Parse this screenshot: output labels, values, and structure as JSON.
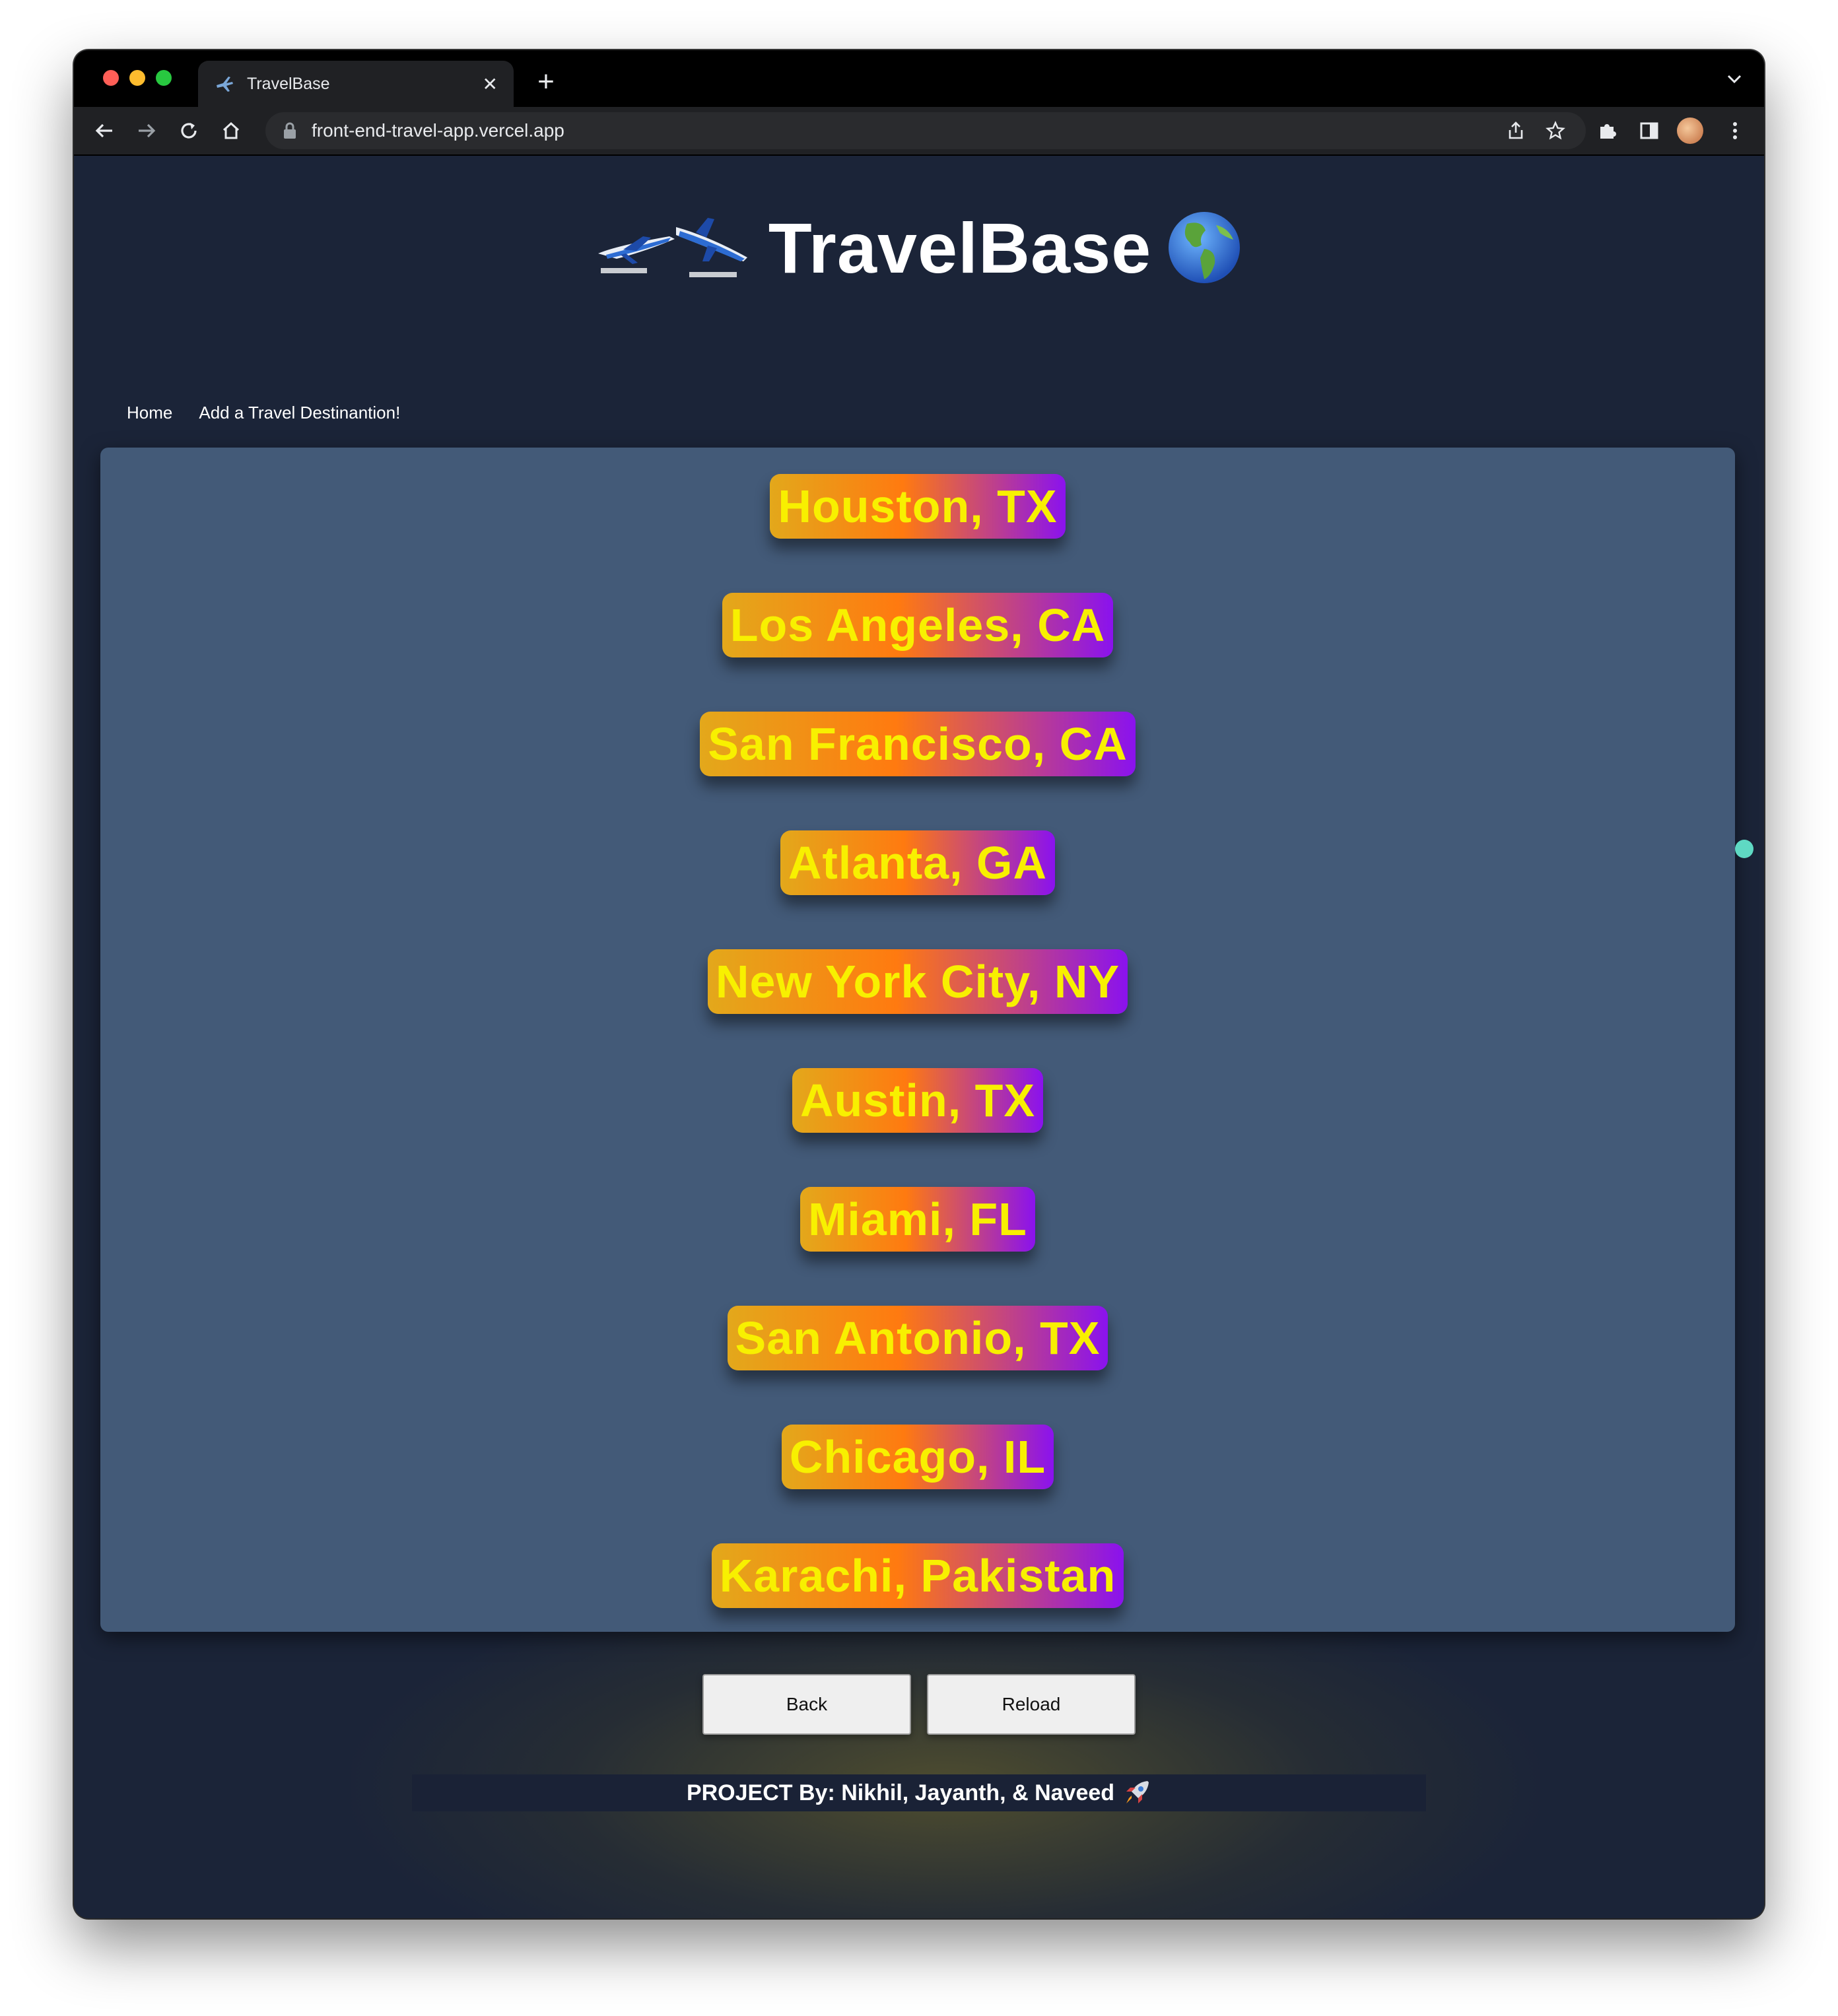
{
  "browser": {
    "tab_title": "TravelBase",
    "new_tab_label": "+",
    "close_label": "✕",
    "url": "front-end-travel-app.vercel.app"
  },
  "site": {
    "title": "TravelBase",
    "nav": [
      "Home",
      "Add a Travel Destinantion!"
    ]
  },
  "destinations": [
    "Houston, TX",
    "Los Angeles, CA",
    "San Francisco, CA",
    "Atlanta, GA",
    "New York City, NY",
    "Austin, TX",
    "Miami, FL",
    "San Antonio, TX",
    "Chicago, IL",
    "Karachi, Pakistan"
  ],
  "buttons": {
    "back": "Back",
    "reload": "Reload"
  },
  "footer": {
    "text": "PROJECT By: Nikhil, Jayanth, & Naveed"
  },
  "colors": {
    "page_bg": "#1b2438",
    "panel_bg": "#435a78",
    "destination_text": "#f8f000",
    "gradient_start": "#e3a81b",
    "gradient_mid": "#ff7a10",
    "gradient_end": "#8a12ee"
  }
}
